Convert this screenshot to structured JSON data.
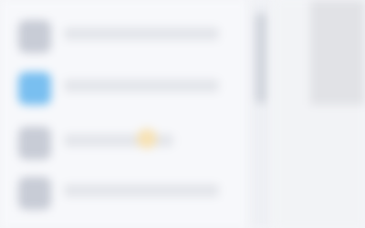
{
  "list": {
    "rows": [
      {
        "label": ""
      },
      {
        "label": ""
      },
      {
        "label": ""
      },
      {
        "label": ""
      }
    ]
  },
  "icons": {
    "avatar": "avatar-icon"
  },
  "colors": {
    "accent_avatar": "#79bff0"
  }
}
